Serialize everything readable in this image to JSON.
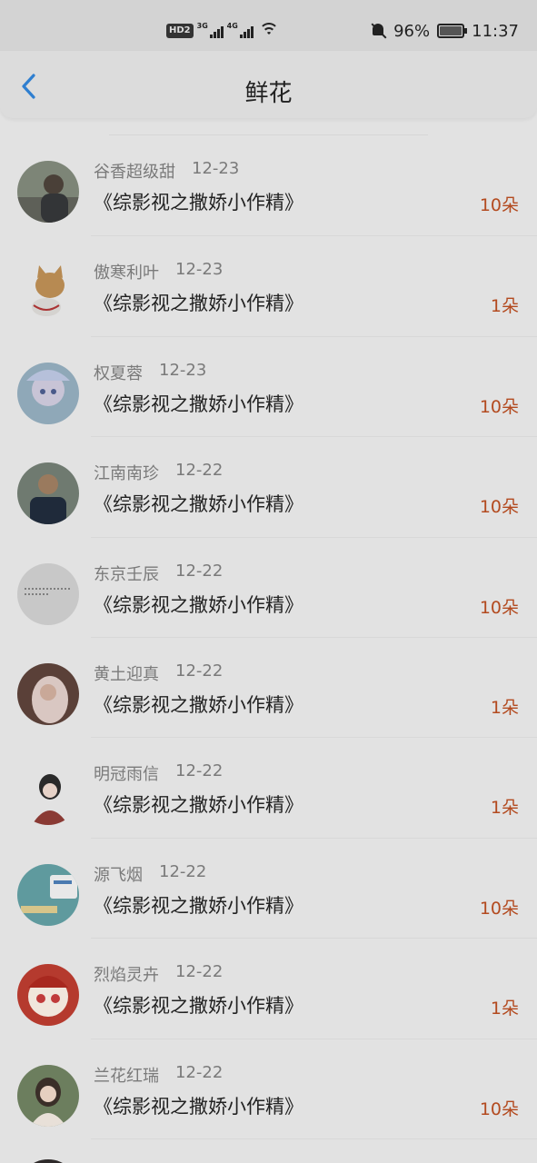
{
  "status_bar": {
    "hd_label": "HD",
    "sim_label": "2",
    "net1": "3G",
    "net2": "4G",
    "battery_pct": "96%",
    "time": "11:37"
  },
  "header": {
    "back_icon": "chevron-left-icon",
    "title": "鲜花"
  },
  "colors": {
    "accent_blue": "#2f7fd0",
    "amount": "#b34a1f",
    "background": "#e2e2e2"
  },
  "list": [
    {
      "name": "谷香超级甜",
      "date": "12-23",
      "book": "《综影视之撒娇小作精》",
      "amount": "10朵"
    },
    {
      "name": "傲寒利叶",
      "date": "12-23",
      "book": "《综影视之撒娇小作精》",
      "amount": "1朵"
    },
    {
      "name": "权夏蓉",
      "date": "12-23",
      "book": "《综影视之撒娇小作精》",
      "amount": "10朵"
    },
    {
      "name": "江南南珍",
      "date": "12-22",
      "book": "《综影视之撒娇小作精》",
      "amount": "10朵"
    },
    {
      "name": "东京壬辰",
      "date": "12-22",
      "book": "《综影视之撒娇小作精》",
      "amount": "10朵"
    },
    {
      "name": "黄土迎真",
      "date": "12-22",
      "book": "《综影视之撒娇小作精》",
      "amount": "1朵"
    },
    {
      "name": "明冠雨信",
      "date": "12-22",
      "book": "《综影视之撒娇小作精》",
      "amount": "1朵"
    },
    {
      "name": "源飞烟",
      "date": "12-22",
      "book": "《综影视之撒娇小作精》",
      "amount": "10朵"
    },
    {
      "name": "烈焰灵卉",
      "date": "12-22",
      "book": "《综影视之撒娇小作精》",
      "amount": "1朵"
    },
    {
      "name": "兰花红瑞",
      "date": "12-22",
      "book": "《综影视之撒娇小作精》",
      "amount": "10朵"
    }
  ]
}
